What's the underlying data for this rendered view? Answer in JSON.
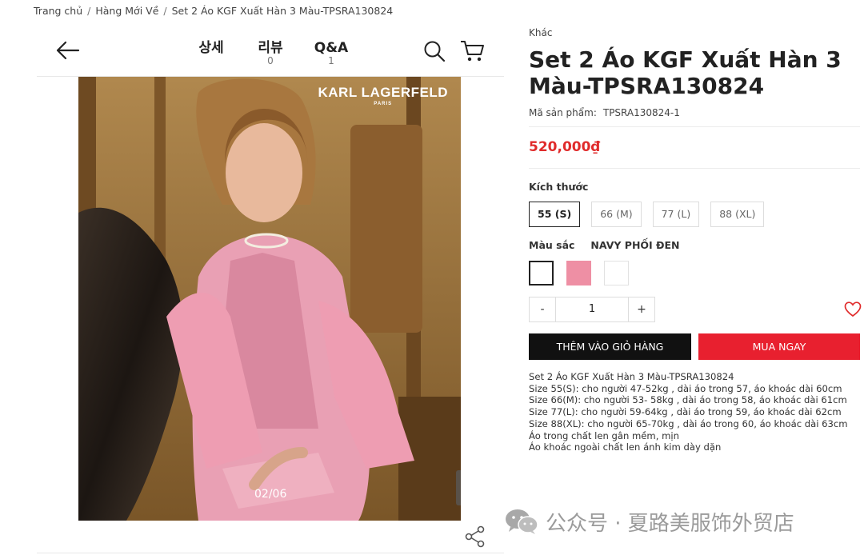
{
  "breadcrumb": {
    "items": [
      "Trang chủ",
      "Hàng Mới Về",
      "Set 2 Áo KGF Xuất Hàn 3 Màu-TPSRA130824"
    ],
    "separator": "/"
  },
  "header": {
    "tabs": [
      {
        "label": "상세",
        "count": ""
      },
      {
        "label": "리뷰",
        "count": "0"
      },
      {
        "label": "Q&A",
        "count": "1"
      }
    ],
    "icons": [
      "back-arrow-icon",
      "search-icon",
      "cart-icon"
    ]
  },
  "gallery": {
    "brand_logo": "KARL LAGERFELD",
    "brand_sub": "PARIS",
    "counter": "02/06",
    "icons": [
      "zoom-icon",
      "share-icon"
    ]
  },
  "product": {
    "category": "Khác",
    "title": "Set 2 Áo KGF Xuất Hàn 3 Màu-TPSRA130824",
    "sku_label": "Mã sản phẩm:",
    "sku_value": "TPSRA130824-1",
    "price": "520,000₫",
    "price_color": "#e02b2b",
    "size_label": "Kích thước",
    "sizes": [
      "55 (S)",
      "66 (M)",
      "77 (L)",
      "88 (XL)"
    ],
    "selected_size": "55 (S)",
    "color_label": "Màu sắc",
    "color_value": "NAVY PHỐI ĐEN",
    "swatches": [
      "#ffffff",
      "#ee8fa4",
      "#ffffff"
    ],
    "quantity": {
      "minus": "-",
      "value": "1",
      "plus": "+"
    },
    "add_to_cart_label": "THÊM VÀO GIỎ HÀNG",
    "buy_now_label": "MUA NGAY",
    "buy_now_color": "#e8202f",
    "description": [
      "Set 2 Áo KGF Xuất Hàn 3 Màu-TPSRA130824",
      "Size 55(S): cho người 47-52kg , dài áo trong 57, áo khoác dài 60cm",
      "Size 66(M): cho người 53- 58kg , dài áo trong 58, áo khoác dài 61cm",
      "Size 77(L): cho người 59-64kg , dài áo trong 59, áo khoác dài 62cm",
      "Size 88(XL): cho người 65-70kg , dài áo trong 60, áo khoác dài 63cm",
      "Áo trong chất len gân mềm, mịn",
      "Áo khoác ngoài chất len ánh kim dày dặn"
    ]
  },
  "watermark": {
    "text": "公众号 · 夏路美服饰外贸店",
    "icon": "wechat-icon"
  }
}
